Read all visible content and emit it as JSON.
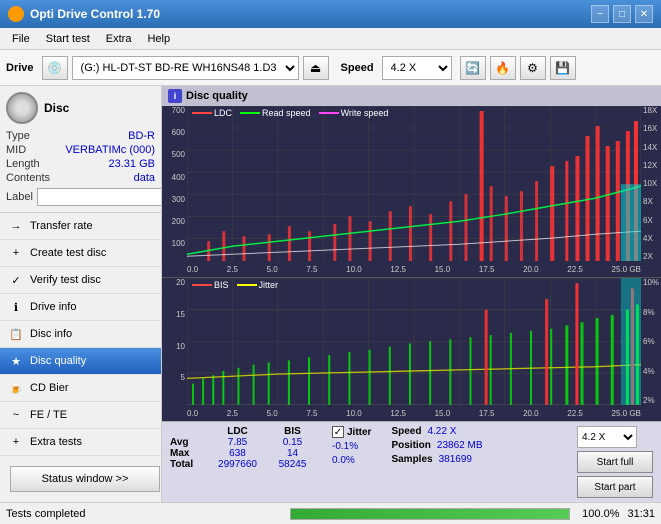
{
  "titlebar": {
    "title": "Opti Drive Control 1.70",
    "minimize": "−",
    "maximize": "□",
    "close": "✕"
  },
  "menubar": {
    "items": [
      "File",
      "Start test",
      "Extra",
      "Help"
    ]
  },
  "toolbar": {
    "drive_label": "Drive",
    "drive_value": "(G:)  HL-DT-ST BD-RE  WH16NS48 1.D3",
    "speed_label": "Speed",
    "speed_value": "4.2 X"
  },
  "disc": {
    "label": "Disc",
    "type_key": "Type",
    "type_val": "BD-R",
    "mid_key": "MID",
    "mid_val": "VERBATIMc (000)",
    "length_key": "Length",
    "length_val": "23.31 GB",
    "contents_key": "Contents",
    "contents_val": "data",
    "label_key": "Label",
    "label_val": ""
  },
  "nav_items": [
    {
      "id": "transfer-rate",
      "label": "Transfer rate",
      "icon": "→"
    },
    {
      "id": "create-test-disc",
      "label": "Create test disc",
      "icon": "💿"
    },
    {
      "id": "verify-test-disc",
      "label": "Verify test disc",
      "icon": "✓"
    },
    {
      "id": "drive-info",
      "label": "Drive info",
      "icon": "ℹ"
    },
    {
      "id": "disc-info",
      "label": "Disc info",
      "icon": "📋"
    },
    {
      "id": "disc-quality",
      "label": "Disc quality",
      "icon": "★",
      "active": true
    },
    {
      "id": "cd-bier",
      "label": "CD Bier",
      "icon": "🍺"
    },
    {
      "id": "fe-te",
      "label": "FE / TE",
      "icon": "~"
    },
    {
      "id": "extra-tests",
      "label": "Extra tests",
      "icon": "+"
    }
  ],
  "status_window_btn": "Status window >>",
  "dq_header": "Disc quality",
  "chart_top": {
    "legend": [
      {
        "label": "LDC",
        "color": "#ff4444"
      },
      {
        "label": "Read speed",
        "color": "#00ff00"
      },
      {
        "label": "Write speed",
        "color": "#ff44ff"
      }
    ],
    "y_axis_left": [
      "700",
      "600",
      "500",
      "400",
      "300",
      "200",
      "100"
    ],
    "y_axis_right": [
      "18X",
      "16X",
      "14X",
      "12X",
      "10X",
      "8X",
      "6X",
      "4X",
      "2X"
    ],
    "x_axis": [
      "0.0",
      "2.5",
      "5.0",
      "7.5",
      "10.0",
      "12.5",
      "15.0",
      "17.5",
      "20.0",
      "22.5",
      "25.0 GB"
    ]
  },
  "chart_bottom": {
    "legend": [
      {
        "label": "BIS",
        "color": "#ff4444"
      },
      {
        "label": "Jitter",
        "color": "#ffff00"
      }
    ],
    "y_axis_left": [
      "20",
      "15",
      "10",
      "5"
    ],
    "y_axis_right": [
      "10%",
      "8%",
      "6%",
      "4%",
      "2%"
    ],
    "x_axis": [
      "0.0",
      "2.5",
      "5.0",
      "7.5",
      "10.0",
      "12.5",
      "15.0",
      "17.5",
      "20.0",
      "22.5",
      "25.0 GB"
    ]
  },
  "stats": {
    "headers": [
      "",
      "LDC",
      "BIS",
      "",
      "Jitter"
    ],
    "avg_label": "Avg",
    "avg_ldc": "7.85",
    "avg_bis": "0.15",
    "avg_jitter": "-0.1%",
    "max_label": "Max",
    "max_ldc": "638",
    "max_bis": "14",
    "max_jitter": "0.0%",
    "total_label": "Total",
    "total_ldc": "2997660",
    "total_bis": "58245",
    "jitter_checked": true,
    "speed_label": "Speed",
    "speed_val": "4.22 X",
    "speed_select": "4.2 X",
    "position_label": "Position",
    "position_val": "23862 MB",
    "samples_label": "Samples",
    "samples_val": "381699",
    "start_full_label": "Start full",
    "start_part_label": "Start part"
  },
  "statusbar": {
    "text": "Tests completed",
    "progress": 100,
    "progress_text": "100.0%",
    "time": "31:31"
  }
}
